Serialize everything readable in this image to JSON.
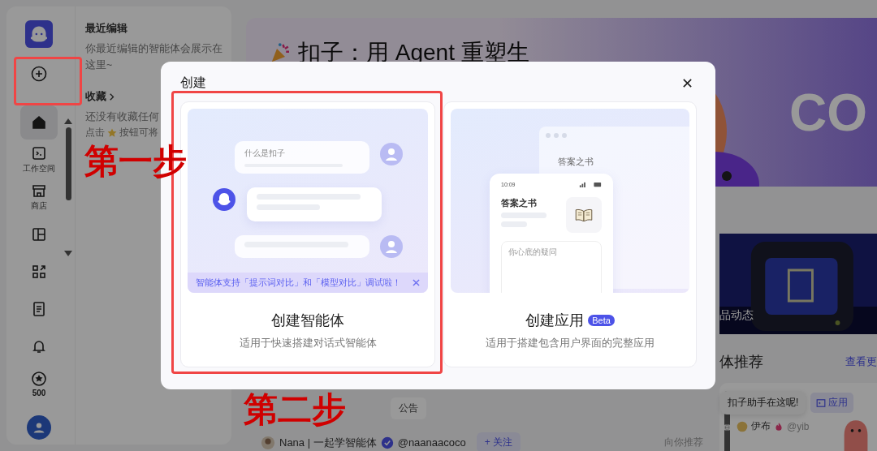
{
  "sidebar": {
    "create_button": {
      "highlighted": true
    },
    "items": [
      {
        "kind": "home",
        "selected": true
      },
      {
        "kind": "workspace",
        "label": "工作空间",
        "selected": false
      },
      {
        "kind": "store",
        "label": "商店",
        "selected": false
      },
      {
        "kind": "layout",
        "selected": false
      },
      {
        "kind": "grid",
        "selected": false
      },
      {
        "kind": "doc",
        "selected": false
      },
      {
        "kind": "bell",
        "selected": false
      },
      {
        "kind": "credits",
        "label": "500",
        "selected": false
      }
    ]
  },
  "recent_panel": {
    "title": "最近编辑",
    "empty_text": "你最近编辑的智能体会展示在这里~",
    "favorites_title": "收藏",
    "favorites_lines": [
      "还没有收藏任何",
      "点击",
      "按钮可将"
    ]
  },
  "banner": {
    "title": "扣子：用 Agent 重塑生",
    "wordmark": "CO"
  },
  "news_card": {
    "label": "品动态"
  },
  "recommend": {
    "title": "体推荐",
    "more_link": "查看更"
  },
  "feed": {
    "tabs": [
      {
        "label": "公告",
        "selected": false
      }
    ],
    "author": "Nana | 一起学智能体",
    "handle": "@naanaacoco",
    "follow": "+ 关注",
    "note": "向你推荐"
  },
  "agent_card": {
    "tag": "应用",
    "author": "伊布",
    "handle": "@yib",
    "tooltip": "扣子助手在这呢!"
  },
  "dialog": {
    "title": "创建",
    "options": [
      {
        "kind": "agent",
        "title": "创建智能体",
        "subtitle": "适用于快速搭建对话式智能体",
        "highlighted": true,
        "notice": "智能体支持「提示词对比」和「模型对比」调试啦！",
        "preview_question": "什么是扣子"
      },
      {
        "kind": "app",
        "title": "创建应用",
        "badge": "Beta",
        "subtitle": "适用于搭建包含用户界面的完整应用",
        "highlighted": false,
        "preview_time": "10:09",
        "window_title": "答案之书",
        "preview_title": "答案之书",
        "preview_placeholder": "你心底的疑问"
      }
    ]
  },
  "annotations": {
    "steps": [
      "第一步",
      "第二步"
    ]
  }
}
